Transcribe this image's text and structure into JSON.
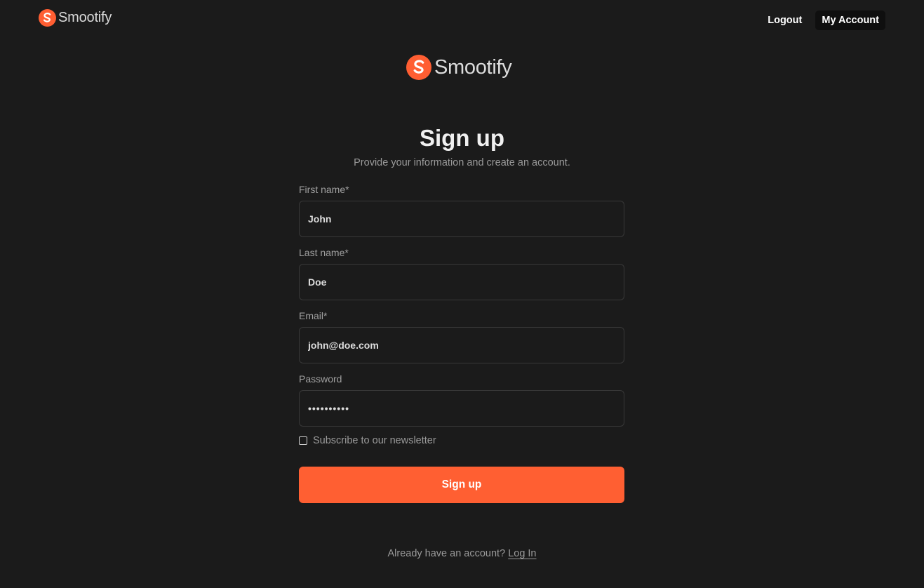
{
  "header": {
    "brand": "Smootify",
    "nav": {
      "logout": "Logout",
      "my_account": "My Account"
    }
  },
  "center_brand": "Smootify",
  "form": {
    "title": "Sign up",
    "subtitle": "Provide your information and create an account.",
    "fields": [
      {
        "label": "First name*",
        "value": "John"
      },
      {
        "label": "Last name*",
        "value": "Doe"
      },
      {
        "label": "Email*",
        "value": "john@doe.com"
      },
      {
        "label": "Password",
        "value": "••••••••••"
      }
    ],
    "newsletter_label": "Subscribe to our newsletter",
    "newsletter_checked": false,
    "submit_label": "Sign up"
  },
  "footer": {
    "prompt": "Already have an account?",
    "login_label": "Log In"
  },
  "colors": {
    "background": "#1b1b1b",
    "accent": "#ff5f32",
    "input_border": "#383838",
    "muted_text": "#9a9a9a"
  },
  "icons": {
    "brand_mark": "smootify-s-logo-icon"
  }
}
